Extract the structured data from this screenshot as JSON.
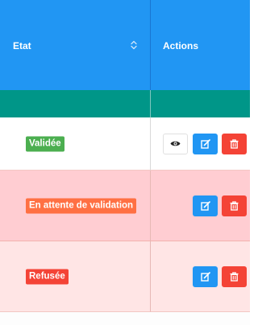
{
  "header": {
    "etat_label": "Etat",
    "actions_label": "Actions"
  },
  "colors": {
    "header": "#2196f3",
    "band": "#009688",
    "validated": "#4caf50",
    "pending": "#ff7043",
    "refused": "#f44336",
    "edit": "#2196f3",
    "delete": "#f44336"
  },
  "rows": [
    {
      "status": "Validée",
      "actions": [
        "eye-icon",
        "edit-icon",
        "trash-icon"
      ]
    },
    {
      "status": "En attente de validation",
      "actions": [
        "edit-icon",
        "trash-icon"
      ]
    },
    {
      "status": "Refusée",
      "actions": [
        "edit-icon",
        "trash-icon"
      ]
    }
  ]
}
